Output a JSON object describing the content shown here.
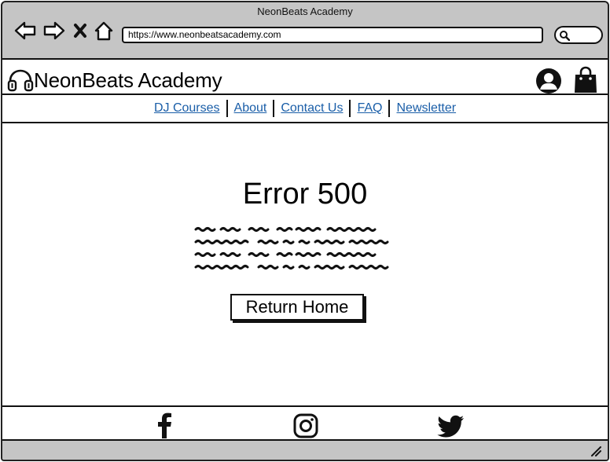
{
  "window": {
    "title": "NeonBeats Academy"
  },
  "toolbar": {
    "url": "https://www.neonbeatsacademy.com",
    "icons": [
      "back-icon",
      "forward-icon",
      "close-icon",
      "home-icon",
      "search-icon"
    ]
  },
  "header": {
    "brand": "NeonBeats Academy",
    "icons": [
      "headphones-icon",
      "account-icon",
      "shopping-bag-icon"
    ]
  },
  "nav": {
    "links": [
      {
        "label": "DJ Courses"
      },
      {
        "label": "About"
      },
      {
        "label": "Contact Us"
      },
      {
        "label": "FAQ"
      },
      {
        "label": "Newsletter"
      }
    ]
  },
  "main": {
    "title": "Error 500",
    "button_label": "Return Home"
  },
  "footer": {
    "icons": [
      "facebook-icon",
      "instagram-icon",
      "twitter-icon"
    ]
  }
}
